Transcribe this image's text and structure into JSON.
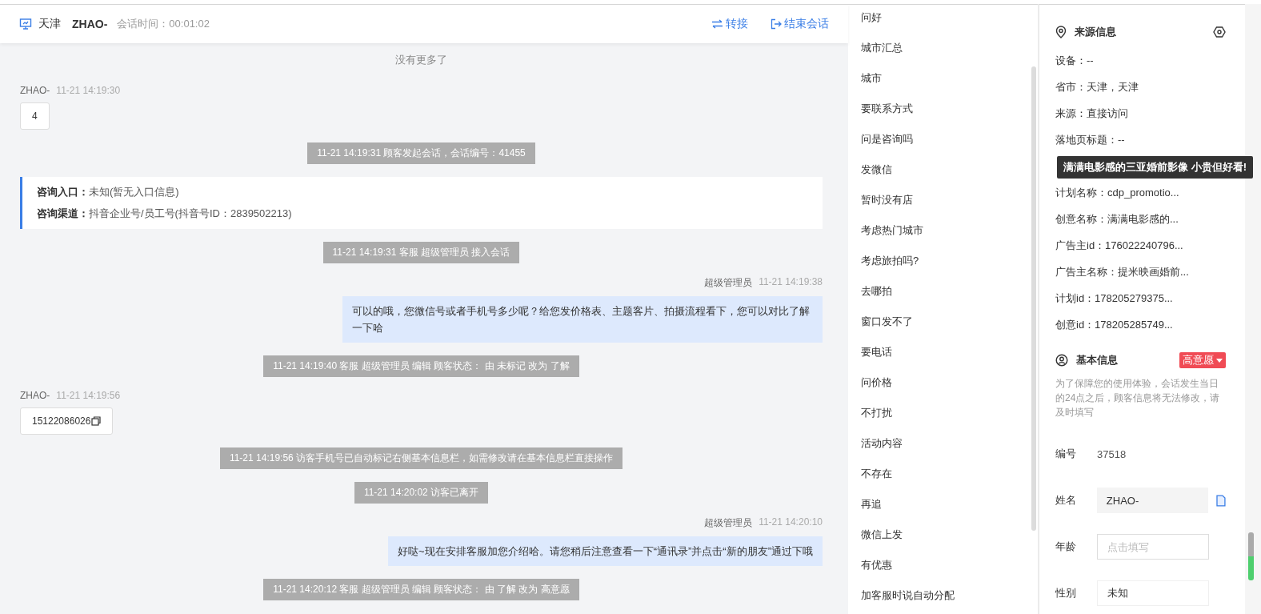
{
  "header": {
    "city": "天津",
    "visitor": "ZHAO-",
    "duration_label": "会话时间：",
    "duration": "00:01:02",
    "actions": [
      {
        "kind": "transfer",
        "label": "转接"
      },
      {
        "kind": "end",
        "label": "结束会话"
      }
    ]
  },
  "chat": {
    "top_note": "没有更多了",
    "messages": [
      {
        "kind": "visitor",
        "sender": "ZHAO-",
        "time": "11-21 14:19:30",
        "text": "4",
        "copyable": false
      },
      {
        "kind": "system",
        "text": "11-21 14:19:31 顾客发起会话，会话编号：41455"
      },
      {
        "kind": "entry",
        "lines": [
          {
            "label": "咨询入口：",
            "value": "未知(暂无入口信息)"
          },
          {
            "label": "咨询渠道：",
            "value": "抖音企业号/员工号(抖音号ID：2839502213)"
          }
        ]
      },
      {
        "kind": "system",
        "text": "11-21 14:19:31 客服 超级管理员 接入会话"
      },
      {
        "kind": "agent",
        "sender": "超级管理员",
        "time": "11-21 14:19:38",
        "text": "可以的哦，您微信号或者手机号多少呢？给您发价格表、主题客片、拍摄流程看下，您可以对比了解一下哈"
      },
      {
        "kind": "system",
        "text": "11-21 14:19:40 客服 超级管理员 编辑 顾客状态： 由 未标记 改为 了解"
      },
      {
        "kind": "visitor",
        "sender": "ZHAO-",
        "time": "11-21 14:19:56",
        "text": "15122086026",
        "copyable": true
      },
      {
        "kind": "system",
        "text": "11-21 14:19:56 访客手机号已自动标记右侧基本信息栏，如需修改请在基本信息栏直接操作"
      },
      {
        "kind": "system",
        "text": "11-21 14:20:02 访客已离开"
      },
      {
        "kind": "agent",
        "sender": "超级管理员",
        "time": "11-21 14:20:10",
        "text": "好哒~现在安排客服加您介绍哈。请您稍后注意查看一下“通讯录”并点击“新的朋友”通过下哦"
      },
      {
        "kind": "system",
        "text": "11-21 14:20:12 客服 超级管理员 编辑 顾客状态： 由 了解 改为 高意愿"
      }
    ]
  },
  "quick_replies": [
    "问好",
    "城市汇总",
    "城市",
    "要联系方式",
    "问是咨询吗",
    "发微信",
    "暂时没有店",
    "考虑热门城市",
    "考虑旅拍吗?",
    "去哪拍",
    "窗口发不了",
    "要电话",
    "问价格",
    "不打扰",
    "活动内容",
    "不存在",
    "再追",
    "微信上发",
    "有优惠",
    "加客服时说自动分配"
  ],
  "source_info": {
    "title": "来源信息",
    "rows": [
      "设备：--",
      "省市：天津，天津",
      "来源：直接访问",
      "落地页标题：--",
      "计划名称：cdp_promotio...",
      "创意名称：满满电影感的...",
      "广告主id：176022240796...",
      "广告主名称：提米映画婚前...",
      "计划id：178205279375...",
      "创意id：178205285749..."
    ],
    "tooltip": "满满电影感的三亚婚前影像 小贵但好看!"
  },
  "basic_info": {
    "title": "基本信息",
    "intent": "高意愿",
    "notice": "为了保障您的使用体验，会话发生当日的24点之后，顾客信息将无法修改，请及时填写",
    "fields": [
      {
        "kind": "text",
        "label": "编号",
        "value": "37518"
      },
      {
        "kind": "readonly",
        "label": "姓名",
        "value": "ZHAO-"
      },
      {
        "kind": "input",
        "label": "年龄",
        "placeholder": "点击填写"
      },
      {
        "kind": "select",
        "label": "性别",
        "value": "未知"
      }
    ]
  }
}
